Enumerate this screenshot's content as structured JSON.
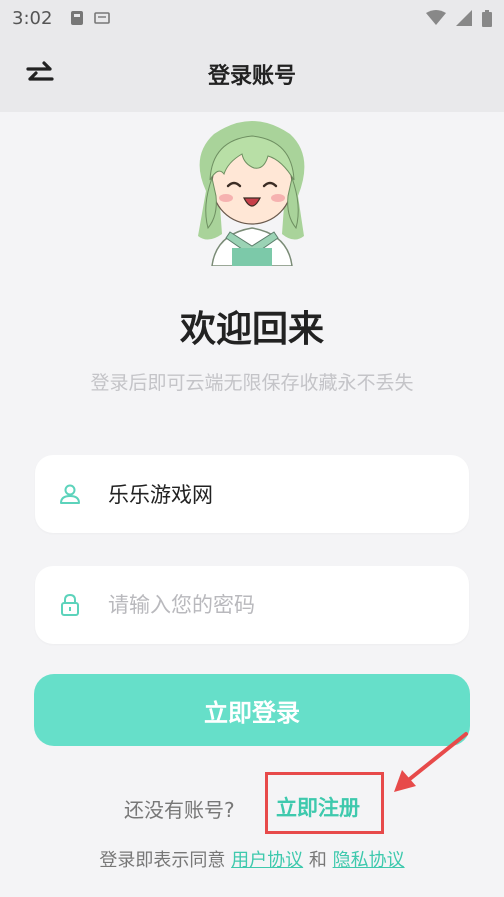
{
  "status_bar": {
    "time": "3:02"
  },
  "header": {
    "title": "登录账号",
    "switch_icon": "swap-arrows-icon"
  },
  "welcome": {
    "title": "欢迎回来",
    "subtitle": "登录后即可云端无限保存收藏永不丢失"
  },
  "form": {
    "username_value": "乐乐游戏网",
    "password_placeholder": "请输入您的密码",
    "login_label": "立即登录"
  },
  "register": {
    "prompt": "还没有账号?",
    "link_label": "立即注册"
  },
  "agreement": {
    "prefix": "登录即表示同意",
    "user_agreement": "用户协议",
    "and": "和",
    "privacy_agreement": "隐私协议"
  },
  "colors": {
    "accent": "#66dfc9",
    "link": "#3ec9ad",
    "highlight": "#e74a4a"
  }
}
